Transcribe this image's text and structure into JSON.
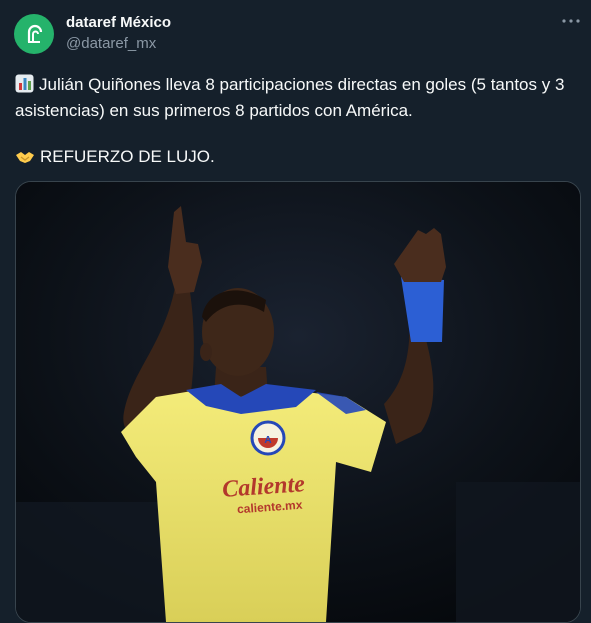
{
  "account": {
    "display_name": "dataref México",
    "handle": "@dataref_mx",
    "avatar_icon": "dataref-logo-icon",
    "avatar_color": "#25b36b"
  },
  "menu": {
    "more_icon": "more-options-icon"
  },
  "tweet": {
    "line1": "Julián Quiñones lleva 8 participaciones directas en goles (5 tantos y 3 asistencias) en sus primeros 8 partidos con América.",
    "line2": "REFUERZO DE LUJO.",
    "emoji1": "bar-chart-emoji",
    "emoji2": "handshake-emoji"
  },
  "media": {
    "description_icon": "player-celebration-photo",
    "jersey_sponsor": "Caliente",
    "jersey_sponsor_url": "caliente.mx"
  }
}
